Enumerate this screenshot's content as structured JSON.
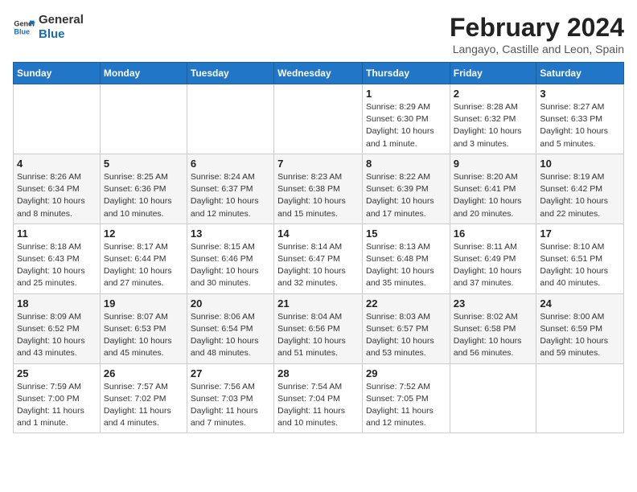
{
  "logo": {
    "line1": "General",
    "line2": "Blue"
  },
  "title": {
    "month_year": "February 2024",
    "location": "Langayo, Castille and Leon, Spain"
  },
  "weekdays": [
    "Sunday",
    "Monday",
    "Tuesday",
    "Wednesday",
    "Thursday",
    "Friday",
    "Saturday"
  ],
  "weeks": [
    [
      {
        "day": "",
        "info": ""
      },
      {
        "day": "",
        "info": ""
      },
      {
        "day": "",
        "info": ""
      },
      {
        "day": "",
        "info": ""
      },
      {
        "day": "1",
        "info": "Sunrise: 8:29 AM\nSunset: 6:30 PM\nDaylight: 10 hours and 1 minute."
      },
      {
        "day": "2",
        "info": "Sunrise: 8:28 AM\nSunset: 6:32 PM\nDaylight: 10 hours and 3 minutes."
      },
      {
        "day": "3",
        "info": "Sunrise: 8:27 AM\nSunset: 6:33 PM\nDaylight: 10 hours and 5 minutes."
      }
    ],
    [
      {
        "day": "4",
        "info": "Sunrise: 8:26 AM\nSunset: 6:34 PM\nDaylight: 10 hours and 8 minutes."
      },
      {
        "day": "5",
        "info": "Sunrise: 8:25 AM\nSunset: 6:36 PM\nDaylight: 10 hours and 10 minutes."
      },
      {
        "day": "6",
        "info": "Sunrise: 8:24 AM\nSunset: 6:37 PM\nDaylight: 10 hours and 12 minutes."
      },
      {
        "day": "7",
        "info": "Sunrise: 8:23 AM\nSunset: 6:38 PM\nDaylight: 10 hours and 15 minutes."
      },
      {
        "day": "8",
        "info": "Sunrise: 8:22 AM\nSunset: 6:39 PM\nDaylight: 10 hours and 17 minutes."
      },
      {
        "day": "9",
        "info": "Sunrise: 8:20 AM\nSunset: 6:41 PM\nDaylight: 10 hours and 20 minutes."
      },
      {
        "day": "10",
        "info": "Sunrise: 8:19 AM\nSunset: 6:42 PM\nDaylight: 10 hours and 22 minutes."
      }
    ],
    [
      {
        "day": "11",
        "info": "Sunrise: 8:18 AM\nSunset: 6:43 PM\nDaylight: 10 hours and 25 minutes."
      },
      {
        "day": "12",
        "info": "Sunrise: 8:17 AM\nSunset: 6:44 PM\nDaylight: 10 hours and 27 minutes."
      },
      {
        "day": "13",
        "info": "Sunrise: 8:15 AM\nSunset: 6:46 PM\nDaylight: 10 hours and 30 minutes."
      },
      {
        "day": "14",
        "info": "Sunrise: 8:14 AM\nSunset: 6:47 PM\nDaylight: 10 hours and 32 minutes."
      },
      {
        "day": "15",
        "info": "Sunrise: 8:13 AM\nSunset: 6:48 PM\nDaylight: 10 hours and 35 minutes."
      },
      {
        "day": "16",
        "info": "Sunrise: 8:11 AM\nSunset: 6:49 PM\nDaylight: 10 hours and 37 minutes."
      },
      {
        "day": "17",
        "info": "Sunrise: 8:10 AM\nSunset: 6:51 PM\nDaylight: 10 hours and 40 minutes."
      }
    ],
    [
      {
        "day": "18",
        "info": "Sunrise: 8:09 AM\nSunset: 6:52 PM\nDaylight: 10 hours and 43 minutes."
      },
      {
        "day": "19",
        "info": "Sunrise: 8:07 AM\nSunset: 6:53 PM\nDaylight: 10 hours and 45 minutes."
      },
      {
        "day": "20",
        "info": "Sunrise: 8:06 AM\nSunset: 6:54 PM\nDaylight: 10 hours and 48 minutes."
      },
      {
        "day": "21",
        "info": "Sunrise: 8:04 AM\nSunset: 6:56 PM\nDaylight: 10 hours and 51 minutes."
      },
      {
        "day": "22",
        "info": "Sunrise: 8:03 AM\nSunset: 6:57 PM\nDaylight: 10 hours and 53 minutes."
      },
      {
        "day": "23",
        "info": "Sunrise: 8:02 AM\nSunset: 6:58 PM\nDaylight: 10 hours and 56 minutes."
      },
      {
        "day": "24",
        "info": "Sunrise: 8:00 AM\nSunset: 6:59 PM\nDaylight: 10 hours and 59 minutes."
      }
    ],
    [
      {
        "day": "25",
        "info": "Sunrise: 7:59 AM\nSunset: 7:00 PM\nDaylight: 11 hours and 1 minute."
      },
      {
        "day": "26",
        "info": "Sunrise: 7:57 AM\nSunset: 7:02 PM\nDaylight: 11 hours and 4 minutes."
      },
      {
        "day": "27",
        "info": "Sunrise: 7:56 AM\nSunset: 7:03 PM\nDaylight: 11 hours and 7 minutes."
      },
      {
        "day": "28",
        "info": "Sunrise: 7:54 AM\nSunset: 7:04 PM\nDaylight: 11 hours and 10 minutes."
      },
      {
        "day": "29",
        "info": "Sunrise: 7:52 AM\nSunset: 7:05 PM\nDaylight: 11 hours and 12 minutes."
      },
      {
        "day": "",
        "info": ""
      },
      {
        "day": "",
        "info": ""
      }
    ]
  ]
}
